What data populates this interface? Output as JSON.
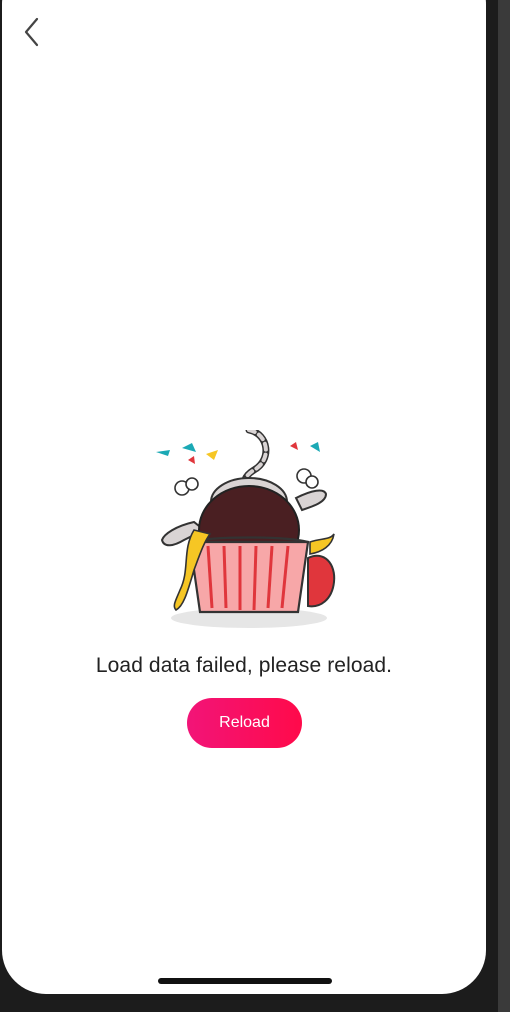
{
  "nav": {
    "back_icon": "chevron-left-icon"
  },
  "empty_state": {
    "illustration": "cat-in-cupcake-gift-box-illustration",
    "message": "Load data failed, please reload.",
    "reload_label": "Reload"
  },
  "colors": {
    "button_gradient_start": "#f21478",
    "button_gradient_end": "#ff0a4a",
    "text": "#222222",
    "background": "#ffffff"
  }
}
